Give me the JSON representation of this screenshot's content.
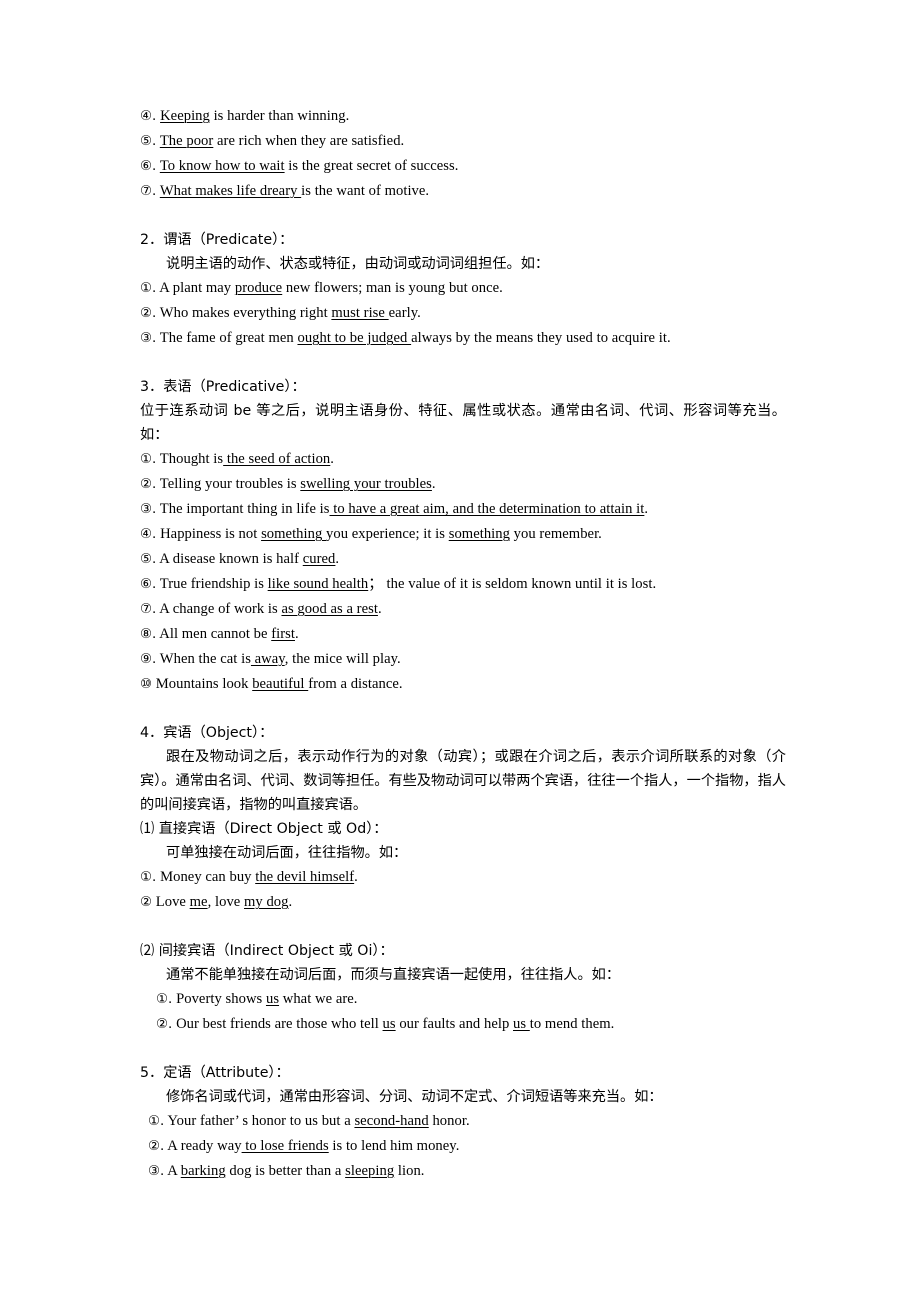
{
  "document": {
    "type": "grammar-notes",
    "language": "zh-CN with English examples",
    "blocks": [
      {
        "kind": "example-list",
        "items": [
          {
            "marker": "④.",
            "prefix": " ",
            "underlined": "Keeping",
            "suffix": " is harder than winning."
          },
          {
            "marker": "⑤.",
            "prefix": " ",
            "underlined": "The poor",
            "suffix": " are rich when they are satisfied."
          },
          {
            "marker": "⑥.",
            "prefix": " ",
            "underlined": "To know how to wait",
            "suffix": " is the great secret of success."
          },
          {
            "marker": "⑦.",
            "prefix": " ",
            "underlined": "What makes life dreary ",
            "suffix": "is the want of motive."
          }
        ]
      },
      {
        "kind": "spacer"
      },
      {
        "kind": "section",
        "heading": "2．谓语（Predicate）：",
        "intro": "说明主语的动作、状态或特征，由动词或动词词组担任。如：",
        "intro_indent": true,
        "items": [
          {
            "marker": "①.",
            "prefix": " A plant may ",
            "underlined": "produce",
            "suffix": " new flowers; man is young but once."
          },
          {
            "marker": "②.",
            "prefix": " Who makes everything right ",
            "underlined": "must rise ",
            "suffix": "early."
          },
          {
            "marker": "③.",
            "prefix": " The fame of great men ",
            "underlined": "ought to be judged ",
            "suffix": "always by the means they used to acquire it."
          }
        ]
      },
      {
        "kind": "spacer"
      },
      {
        "kind": "section",
        "heading": "3．表语（Predicative）：",
        "intro": "位于连系动词 be 等之后，说明主语身份、特征、属性或状态。通常由名词、代词、形容词等充当。如：",
        "intro_indent": false,
        "items": [
          {
            "marker": "①.",
            "prefix": " Thought is",
            "underlined": " the seed of action",
            "suffix": "."
          },
          {
            "marker": "②.",
            "prefix": " Telling your troubles is ",
            "underlined": "swelling your troubles",
            "suffix": "."
          },
          {
            "marker": "③.",
            "prefix": " The important thing in life is",
            "underlined": " to have a great aim, and the determination to attain it",
            "suffix": "."
          },
          {
            "marker": "④.",
            "prefix": " Happiness is not ",
            "underlined": "something ",
            "suffix": "you experience; it is ",
            "underlined2": "something",
            "suffix2": " you remember."
          },
          {
            "marker": "⑤.",
            "prefix": " A disease known is half ",
            "underlined": "cured",
            "suffix": "."
          },
          {
            "marker": "⑥.",
            "prefix": " True friendship is ",
            "underlined": "like sound health",
            "suffix": "；  the value of it is seldom known until it is lost."
          },
          {
            "marker": "⑦.",
            "prefix": " A change of work is ",
            "underlined": "as good as a rest",
            "suffix": "."
          },
          {
            "marker": "⑧.",
            "prefix": " All men cannot be ",
            "underlined": "first",
            "suffix": "."
          },
          {
            "marker": "⑨.",
            "prefix": " When the cat is",
            "underlined": " away",
            "suffix": ", the mice will play."
          },
          {
            "marker": "⑩",
            "prefix": " Mountains look ",
            "underlined": "beautiful ",
            "suffix": "from a distance."
          }
        ]
      },
      {
        "kind": "spacer"
      },
      {
        "kind": "section",
        "heading": "4．宾语（Object）：",
        "intro": "跟在及物动词之后，表示动作行为的对象（动宾）；或跟在介词之后，表示介词所联系的对象（介宾）。通常由名词、代词、数词等担任。有些及物动词可以带两个宾语，往往一个指人，一个指物，指人的叫间接宾语，指物的叫直接宾语。",
        "intro_indent": true,
        "subsections": [
          {
            "label": "⑴ 直接宾语（Direct Object 或 Od）：",
            "intro": "可单独接在动词后面，往往指物。如：",
            "items": [
              {
                "marker": "①.",
                "prefix": " Money can buy ",
                "underlined": "the devil himself",
                "suffix": "."
              },
              {
                "marker": "②",
                "prefix": " Love ",
                "underlined": "me",
                "suffix": ", love ",
                "underlined2": "my dog",
                "suffix2": "."
              }
            ]
          },
          {
            "kind": "spacer"
          },
          {
            "label": "⑵ 间接宾语（Indirect Object 或 Oi）：",
            "intro": "通常不能单独接在动词后面，而须与直接宾语一起使用，往往指人。如：",
            "items": [
              {
                "marker": "①.",
                "prefix": " Poverty shows ",
                "underlined": "us",
                "suffix": " what we are."
              },
              {
                "marker": "②.",
                "prefix": " Our best friends are those who tell ",
                "underlined": "us",
                "suffix": " our faults and help ",
                "underlined2": "us ",
                "suffix2": "to mend them."
              }
            ]
          }
        ]
      },
      {
        "kind": "spacer"
      },
      {
        "kind": "section",
        "heading": "5．定语（Attribute）：",
        "intro": "修饰名词或代词，通常由形容词、分词、动词不定式、介词短语等来充当。如：",
        "intro_indent": true,
        "items": [
          {
            "marker": "①.",
            "prefix": " Your father’ s honor to us but a ",
            "underlined": "second-hand",
            "suffix": " honor."
          },
          {
            "marker": "②.",
            "prefix": " A ready way",
            "underlined": " to lose friends",
            "suffix": " is to lend him money."
          },
          {
            "marker": "③.",
            "prefix": " A ",
            "underlined": "barking",
            "suffix": " dog is better than a ",
            "underlined2": "sleeping",
            "suffix2": " lion."
          }
        ]
      }
    ]
  }
}
